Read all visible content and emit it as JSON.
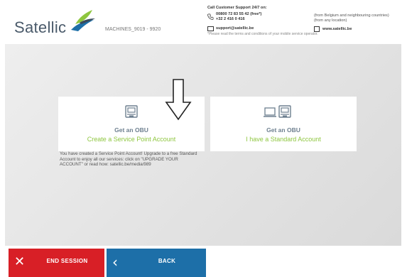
{
  "header": {
    "logo_text": "Satellic",
    "machine_id": "MACHINES_9019 - 9920",
    "support": {
      "title": "Call Customer Support 24/7 on:",
      "phone1": "00800 72 83 55 42 (free*)",
      "phone2": "+32 2 416 0 416",
      "note1": "(from Belgium and neighbouring countries)",
      "note2": "(from any location)",
      "email": "support@satellic.be",
      "website": "www.satellic.be",
      "disclaimer": "*Please read the terms and conditions of your mobile service operator."
    }
  },
  "cards": [
    {
      "title": "Get an OBU",
      "subtitle": "Create a Service Point Account",
      "icon": "obu-device-icon"
    },
    {
      "title": "Get an OBU",
      "subtitle": "I have a Standard Account",
      "icon": "computer-obu-icon"
    }
  ],
  "upgrade_text": "You have created a Service Point Account! Upgrade to a free Standard Account to enjoy all our services: click on \"UPGRADE YOUR ACCOUNT\" or read how: satellic.be/media/989",
  "bottom": {
    "end_session_label": "END SESSION",
    "back_label": "BACK",
    "end_color": "#d81f26",
    "back_color": "#1d6fa8"
  },
  "colors": {
    "accent_green": "#8ec63f",
    "title_gray": "#6d7f8f"
  }
}
